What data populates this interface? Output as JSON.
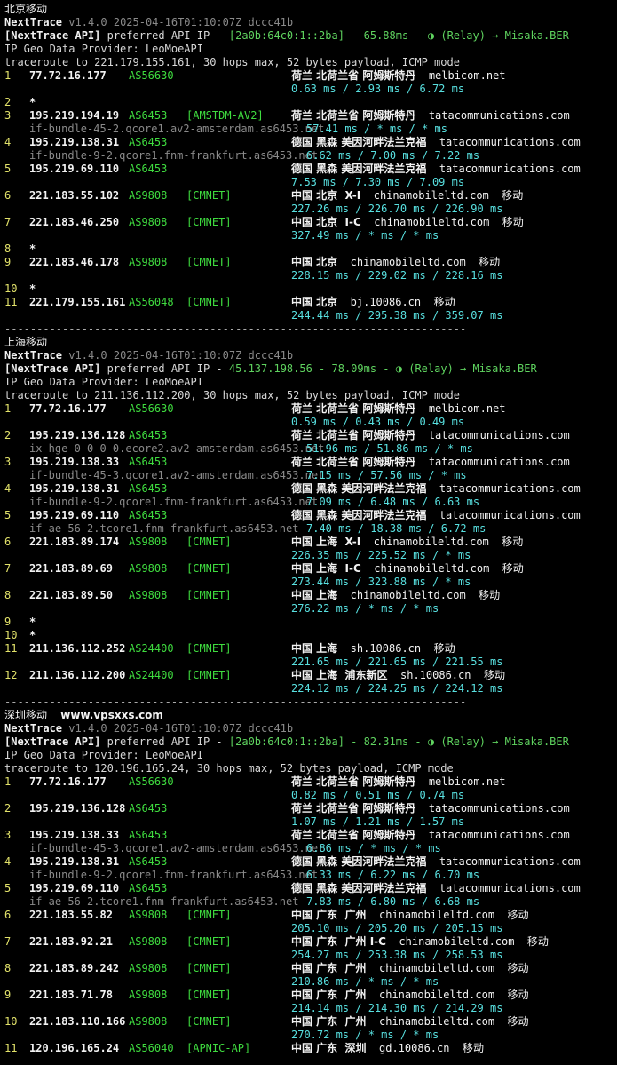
{
  "colors": {
    "background": "#000000",
    "text": "#d8d8d8",
    "gray": "#8a8a8a",
    "yellow": "#e2e26a",
    "green": "#3fdc3f",
    "cyan": "#58e0e0"
  },
  "separator": "------------------------------------------------------------------------",
  "sections": [
    {
      "location": "北京移动",
      "watermark": "",
      "app_name": "NextTrace",
      "version_line": "v1.4.0 2025-04-16T01:10:07Z dccc41b",
      "api_prefix": "[NextTrace API]",
      "api_label": "preferred API IP -",
      "api_ip": "[2a0b:64c0:1::2ba]",
      "api_latency": "- 65.88ms -",
      "api_relay": "(Relay) → Misaka.BER",
      "geo_provider": "IP Geo Data Provider: LeoMoeAPI",
      "traceroute": "traceroute to 221.179.155.161, 30 hops max, 52 bytes payload, ICMP mode",
      "hops": [
        {
          "n": "1",
          "ip": "77.72.16.177",
          "as": "AS56630",
          "tag": "",
          "geo": "荷兰 北荷兰省 阿姆斯特丹",
          "domain": "melbicom.net",
          "isp": "",
          "host": "",
          "rtt": "0.63 ms / 2.93 ms / 6.72 ms"
        },
        {
          "n": "2",
          "ip": "*",
          "as": "",
          "tag": "",
          "geo": "",
          "domain": "",
          "isp": "",
          "host": "",
          "rtt": ""
        },
        {
          "n": "3",
          "ip": "195.219.194.19",
          "as": "AS6453",
          "tag": "[AMSTDM-AV2]",
          "geo": "荷兰 北荷兰省 阿姆斯特丹",
          "domain": "tatacommunications.com",
          "isp": "",
          "host": "if-bundle-45-2.qcore1.av2-amsterdam.as6453.net",
          "rtt": "57.41 ms / * ms / * ms"
        },
        {
          "n": "4",
          "ip": "195.219.138.31",
          "as": "AS6453",
          "tag": "",
          "geo": "德国 黑森 美因河畔法兰克福",
          "domain": "tatacommunications.com",
          "isp": "",
          "host": "if-bundle-9-2.qcore1.fnm-frankfurt.as6453.net",
          "rtt": "6.62 ms / 7.00 ms / 7.22 ms"
        },
        {
          "n": "5",
          "ip": "195.219.69.110",
          "as": "AS6453",
          "tag": "",
          "geo": "德国 黑森 美因河畔法兰克福",
          "domain": "tatacommunications.com",
          "isp": "",
          "host": "",
          "rtt": "7.53 ms / 7.30 ms / 7.09 ms"
        },
        {
          "n": "6",
          "ip": "221.183.55.102",
          "as": "AS9808",
          "tag": "[CMNET]",
          "geo": "中国 北京  X-I",
          "domain": "chinamobileltd.com",
          "isp": "移动",
          "host": "",
          "rtt": "227.26 ms / 226.70 ms / 226.90 ms"
        },
        {
          "n": "7",
          "ip": "221.183.46.250",
          "as": "AS9808",
          "tag": "[CMNET]",
          "geo": "中国 北京  I-C",
          "domain": "chinamobileltd.com",
          "isp": "移动",
          "host": "",
          "rtt": "327.49 ms / * ms / * ms"
        },
        {
          "n": "8",
          "ip": "*",
          "as": "",
          "tag": "",
          "geo": "",
          "domain": "",
          "isp": "",
          "host": "",
          "rtt": ""
        },
        {
          "n": "9",
          "ip": "221.183.46.178",
          "as": "AS9808",
          "tag": "[CMNET]",
          "geo": "中国 北京",
          "domain": "chinamobileltd.com",
          "isp": "移动",
          "host": "",
          "rtt": "228.15 ms / 229.02 ms / 228.16 ms"
        },
        {
          "n": "10",
          "ip": "*",
          "as": "",
          "tag": "",
          "geo": "",
          "domain": "",
          "isp": "",
          "host": "",
          "rtt": ""
        },
        {
          "n": "11",
          "ip": "221.179.155.161",
          "as": "AS56048",
          "tag": "[CMNET]",
          "geo": "中国 北京",
          "domain": "bj.10086.cn",
          "isp": "移动",
          "host": "",
          "rtt": "244.44 ms / 295.38 ms / 359.07 ms"
        }
      ]
    },
    {
      "location": "上海移动",
      "watermark": "",
      "app_name": "NextTrace",
      "version_line": "v1.4.0 2025-04-16T01:10:07Z dccc41b",
      "api_prefix": "[NextTrace API]",
      "api_label": "preferred API IP -",
      "api_ip": "45.137.198.56",
      "api_latency": "- 78.09ms -",
      "api_relay": "(Relay) → Misaka.BER",
      "geo_provider": "IP Geo Data Provider: LeoMoeAPI",
      "traceroute": "traceroute to 211.136.112.200, 30 hops max, 52 bytes payload, ICMP mode",
      "hops": [
        {
          "n": "1",
          "ip": "77.72.16.177",
          "as": "AS56630",
          "tag": "",
          "geo": "荷兰 北荷兰省 阿姆斯特丹",
          "domain": "melbicom.net",
          "isp": "",
          "host": "",
          "rtt": "0.59 ms / 0.43 ms / 0.49 ms"
        },
        {
          "n": "2",
          "ip": "195.219.136.128",
          "as": "AS6453",
          "tag": "",
          "geo": "荷兰 北荷兰省 阿姆斯特丹",
          "domain": "tatacommunications.com",
          "isp": "",
          "host": "ix-hge-0-0-0-0.ecore2.av2-amsterdam.as6453.net",
          "rtt": "51.96 ms / 51.86 ms / * ms"
        },
        {
          "n": "3",
          "ip": "195.219.138.33",
          "as": "AS6453",
          "tag": "",
          "geo": "荷兰 北荷兰省 阿姆斯特丹",
          "domain": "tatacommunications.com",
          "isp": "",
          "host": "if-bundle-45-3.qcore1.av2-amsterdam.as6453.net",
          "rtt": "7.15 ms / 57.56 ms / * ms"
        },
        {
          "n": "4",
          "ip": "195.219.138.31",
          "as": "AS6453",
          "tag": "",
          "geo": "德国 黑森 美因河畔法兰克福",
          "domain": "tatacommunications.com",
          "isp": "",
          "host": "if-bundle-9-2.qcore1.fnm-frankfurt.as6453.net",
          "rtt": "7.09 ms / 6.48 ms / 6.63 ms"
        },
        {
          "n": "5",
          "ip": "195.219.69.110",
          "as": "AS6453",
          "tag": "",
          "geo": "德国 黑森 美因河畔法兰克福",
          "domain": "tatacommunications.com",
          "isp": "",
          "host": "if-ae-56-2.tcore1.fnm-frankfurt.as6453.net",
          "rtt": "7.40 ms / 18.38 ms / 6.72 ms"
        },
        {
          "n": "6",
          "ip": "221.183.89.174",
          "as": "AS9808",
          "tag": "[CMNET]",
          "geo": "中国 上海  X-I",
          "domain": "chinamobileltd.com",
          "isp": "移动",
          "host": "",
          "rtt": "226.35 ms / 225.52 ms / * ms"
        },
        {
          "n": "7",
          "ip": "221.183.89.69",
          "as": "AS9808",
          "tag": "[CMNET]",
          "geo": "中国 上海  I-C",
          "domain": "chinamobileltd.com",
          "isp": "移动",
          "host": "",
          "rtt": "273.44 ms / 323.88 ms / * ms"
        },
        {
          "n": "8",
          "ip": "221.183.89.50",
          "as": "AS9808",
          "tag": "[CMNET]",
          "geo": "中国 上海",
          "domain": "chinamobileltd.com",
          "isp": "移动",
          "host": "",
          "rtt": "276.22 ms / * ms / * ms"
        },
        {
          "n": "9",
          "ip": "*",
          "as": "",
          "tag": "",
          "geo": "",
          "domain": "",
          "isp": "",
          "host": "",
          "rtt": ""
        },
        {
          "n": "10",
          "ip": "*",
          "as": "",
          "tag": "",
          "geo": "",
          "domain": "",
          "isp": "",
          "host": "",
          "rtt": ""
        },
        {
          "n": "11",
          "ip": "211.136.112.252",
          "as": "AS24400",
          "tag": "[CMNET]",
          "geo": "中国 上海",
          "domain": "sh.10086.cn",
          "isp": "移动",
          "host": "",
          "rtt": "221.65 ms / 221.65 ms / 221.55 ms"
        },
        {
          "n": "12",
          "ip": "211.136.112.200",
          "as": "AS24400",
          "tag": "[CMNET]",
          "geo": "中国 上海  浦东新区",
          "domain": "sh.10086.cn",
          "isp": "移动",
          "host": "",
          "rtt": "224.12 ms / 224.25 ms / 224.12 ms"
        }
      ]
    },
    {
      "location": "深圳移动",
      "watermark": "www.vpsxxs.com",
      "app_name": "NextTrace",
      "version_line": "v1.4.0 2025-04-16T01:10:07Z dccc41b",
      "api_prefix": "[NextTrace API]",
      "api_label": "preferred API IP -",
      "api_ip": "[2a0b:64c0:1::2ba]",
      "api_latency": "- 82.31ms -",
      "api_relay": "(Relay) → Misaka.BER",
      "geo_provider": "IP Geo Data Provider: LeoMoeAPI",
      "traceroute": "traceroute to 120.196.165.24, 30 hops max, 52 bytes payload, ICMP mode",
      "hops": [
        {
          "n": "1",
          "ip": "77.72.16.177",
          "as": "AS56630",
          "tag": "",
          "geo": "荷兰 北荷兰省 阿姆斯特丹",
          "domain": "melbicom.net",
          "isp": "",
          "host": "",
          "rtt": "0.82 ms / 0.51 ms / 0.74 ms"
        },
        {
          "n": "2",
          "ip": "195.219.136.128",
          "as": "AS6453",
          "tag": "",
          "geo": "荷兰 北荷兰省 阿姆斯特丹",
          "domain": "tatacommunications.com",
          "isp": "",
          "host": "",
          "rtt": "1.07 ms / 1.21 ms / 1.57 ms"
        },
        {
          "n": "3",
          "ip": "195.219.138.33",
          "as": "AS6453",
          "tag": "",
          "geo": "荷兰 北荷兰省 阿姆斯特丹",
          "domain": "tatacommunications.com",
          "isp": "",
          "host": "if-bundle-45-3.qcore1.av2-amsterdam.as6453.net",
          "rtt": "6.86 ms / * ms / * ms"
        },
        {
          "n": "4",
          "ip": "195.219.138.31",
          "as": "AS6453",
          "tag": "",
          "geo": "德国 黑森 美因河畔法兰克福",
          "domain": "tatacommunications.com",
          "isp": "",
          "host": "if-bundle-9-2.qcore1.fnm-frankfurt.as6453.net",
          "rtt": "6.33 ms / 6.22 ms / 6.70 ms"
        },
        {
          "n": "5",
          "ip": "195.219.69.110",
          "as": "AS6453",
          "tag": "",
          "geo": "德国 黑森 美因河畔法兰克福",
          "domain": "tatacommunications.com",
          "isp": "",
          "host": "if-ae-56-2.tcore1.fnm-frankfurt.as6453.net",
          "rtt": "7.83 ms / 6.80 ms / 6.68 ms"
        },
        {
          "n": "6",
          "ip": "221.183.55.82",
          "as": "AS9808",
          "tag": "[CMNET]",
          "geo": "中国 广东  广州",
          "domain": "chinamobileltd.com",
          "isp": "移动",
          "host": "",
          "rtt": "205.10 ms / 205.20 ms / 205.15 ms"
        },
        {
          "n": "7",
          "ip": "221.183.92.21",
          "as": "AS9808",
          "tag": "[CMNET]",
          "geo": "中国 广东  广州 I-C",
          "domain": "chinamobileltd.com",
          "isp": "移动",
          "host": "",
          "rtt": "254.27 ms / 253.38 ms / 258.53 ms"
        },
        {
          "n": "8",
          "ip": "221.183.89.242",
          "as": "AS9808",
          "tag": "[CMNET]",
          "geo": "中国 广东  广州",
          "domain": "chinamobileltd.com",
          "isp": "移动",
          "host": "",
          "rtt": "210.86 ms / * ms / * ms"
        },
        {
          "n": "9",
          "ip": "221.183.71.78",
          "as": "AS9808",
          "tag": "[CMNET]",
          "geo": "中国 广东  广州",
          "domain": "chinamobileltd.com",
          "isp": "移动",
          "host": "",
          "rtt": "214.14 ms / 214.30 ms / 214.29 ms"
        },
        {
          "n": "10",
          "ip": "221.183.110.166",
          "as": "AS9808",
          "tag": "[CMNET]",
          "geo": "中国 广东  广州",
          "domain": "chinamobileltd.com",
          "isp": "移动",
          "host": "",
          "rtt": "270.72 ms / * ms / * ms"
        },
        {
          "n": "11",
          "ip": "120.196.165.24",
          "as": "AS56040",
          "tag": "[APNIC-AP]",
          "geo": "中国 广东  深圳",
          "domain": "gd.10086.cn",
          "isp": "移动",
          "host": "",
          "rtt": ""
        }
      ]
    }
  ]
}
